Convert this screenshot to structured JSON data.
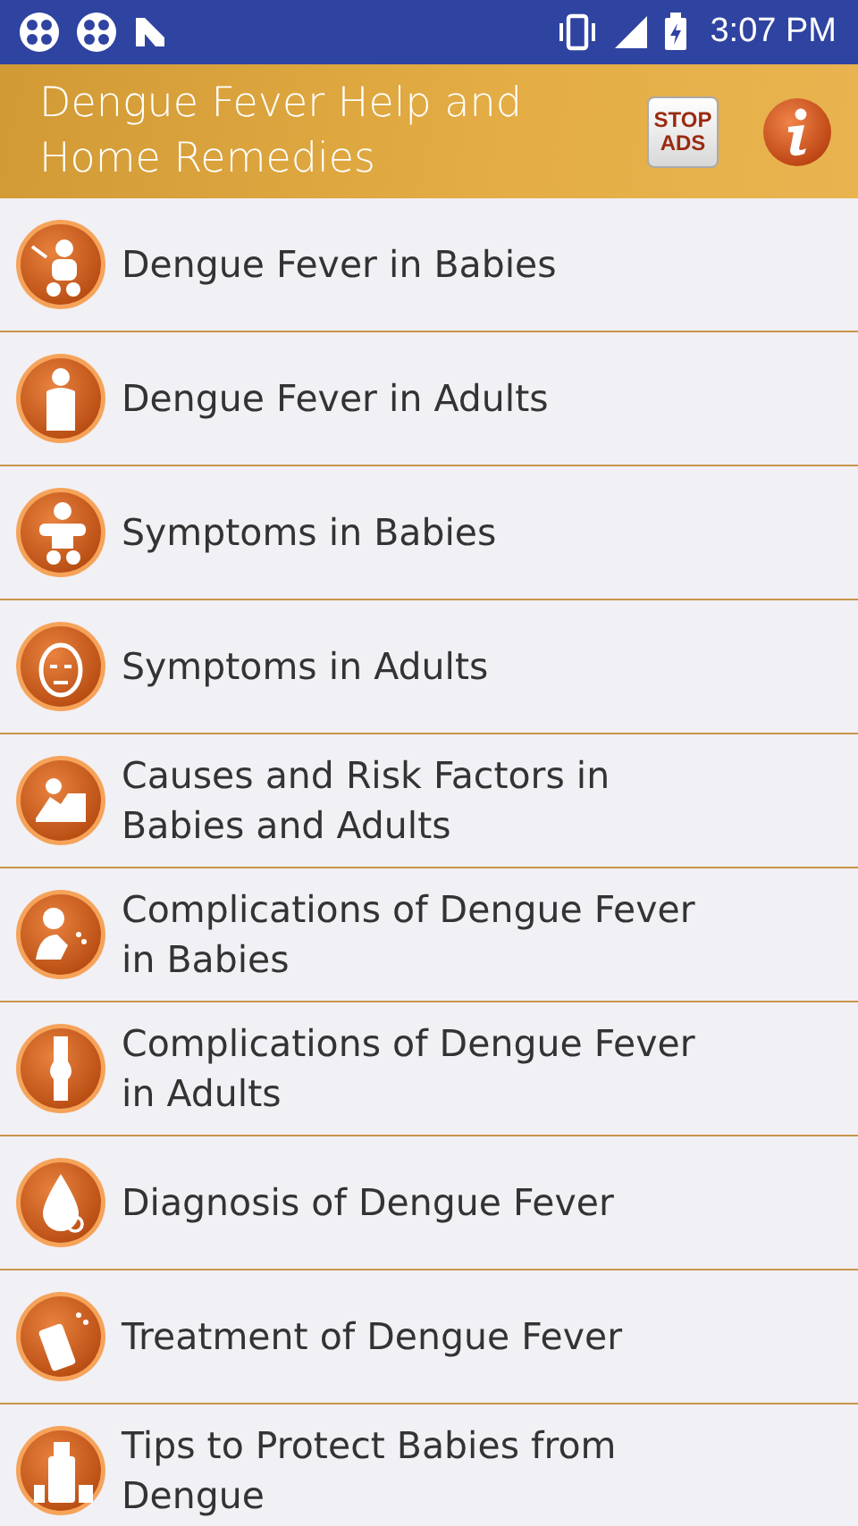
{
  "status_bar": {
    "time": "3:07 PM"
  },
  "app_bar": {
    "title": "Dengue Fever Help and Home Remedies",
    "stop_ads": {
      "line_1": "STOP",
      "line_2": "ADS"
    }
  },
  "topics": [
    {
      "label": "Dengue Fever in Babies"
    },
    {
      "label": "Dengue Fever in Adults"
    },
    {
      "label": "Symptoms in Babies"
    },
    {
      "label": "Symptoms in Adults"
    },
    {
      "label": "Causes and Risk Factors in Babies and Adults"
    },
    {
      "label": "Complications of Dengue Fever in Babies"
    },
    {
      "label": "Complications of Dengue Fever in Adults"
    },
    {
      "label": "Diagnosis of Dengue Fever"
    },
    {
      "label": "Treatment of Dengue Fever"
    },
    {
      "label": "Tips to Protect Babies from Dengue"
    }
  ]
}
